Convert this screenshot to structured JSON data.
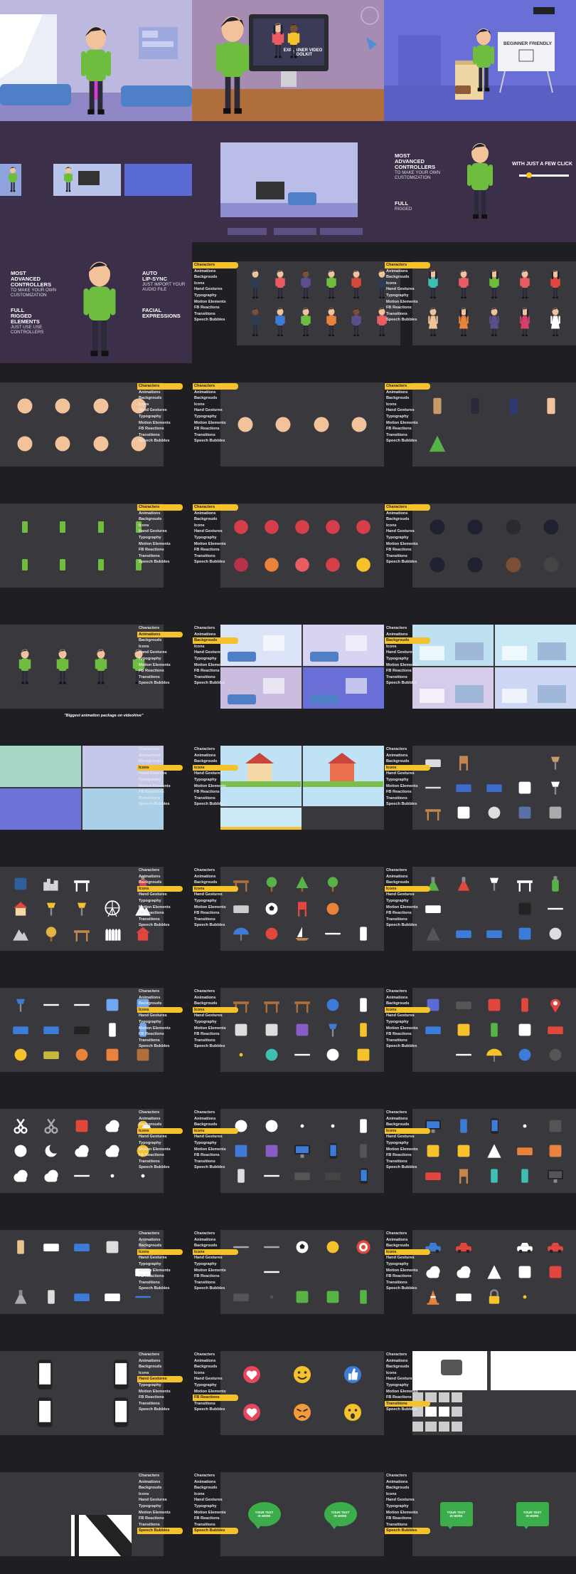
{
  "hero": {
    "panel2_screen_label": "EXPLAINER VIDEO TOOLKIT",
    "panel3_badge": "BEGINNER FRIENDLY"
  },
  "features": {
    "most": "MOST",
    "advanced": "ADVANCED",
    "controllers": "CONTROLLERS",
    "to_make": "TO MAKE YOUR OWN",
    "customization": "CUSTOMIZATION",
    "full": "FULL",
    "rigged": "RIGGED",
    "elements": "ELEMENTS",
    "just_use": "JUST USE USE",
    "controllers_small": "CONTROLLERS",
    "auto": "AUTO",
    "lip_sync": "LIP-SYNC",
    "just_import": "JUST IMPORT YOUR",
    "audio_file": "AUDIO FILE",
    "facial": "FACIAL",
    "expressions": "EXPRESSIONS",
    "few_clicks": "WITH JUST A FEW CLICK",
    "rigged_small": "RIGGED"
  },
  "menu_items": [
    "Characters",
    "Animations",
    "Backgrouds",
    "Icons",
    "Hand Gestures",
    "Typography",
    "Motion Elements",
    "FB Reactions",
    "Transitions",
    "Speech Bubbles"
  ],
  "caption": "\"Biggest animation package on videohive\"",
  "speech_bubble_text": "YOUR TEXT IS HERE",
  "colors": {
    "accent": "#f5c22b",
    "panel_bg": "#39383d",
    "page_bg": "#1f1e23",
    "hero_purple": "#7a5b85",
    "hero_blue": "#5a6bd6",
    "shirt_green": "#6fbd3f"
  },
  "icons": [
    "bathtub-icon",
    "chair-icon",
    "radiator-icon",
    "window-icon",
    "lamp-icon",
    "trophy-icon",
    "house-icon",
    "shop-icon",
    "rock-icon",
    "tree-icon",
    "bench-icon",
    "ball-icon",
    "lifebuoy-icon",
    "boat-icon",
    "gavel-icon",
    "flask-icon",
    "microscope-icon",
    "telescope-icon",
    "sofa-icon",
    "fire-extinguisher-icon",
    "umbrella-icon",
    "scissors-icon",
    "sun-icon",
    "moon-icon",
    "cloud-icon",
    "monitor-icon",
    "smartphone-icon",
    "laptop-icon",
    "soccer-ball-icon",
    "target-icon",
    "car-icon",
    "truck-icon",
    "cone-icon",
    "padlock-icon",
    "like-icon",
    "heart-icon",
    "angry-icon",
    "wow-icon",
    "laugh-icon",
    "map-pin-icon"
  ]
}
